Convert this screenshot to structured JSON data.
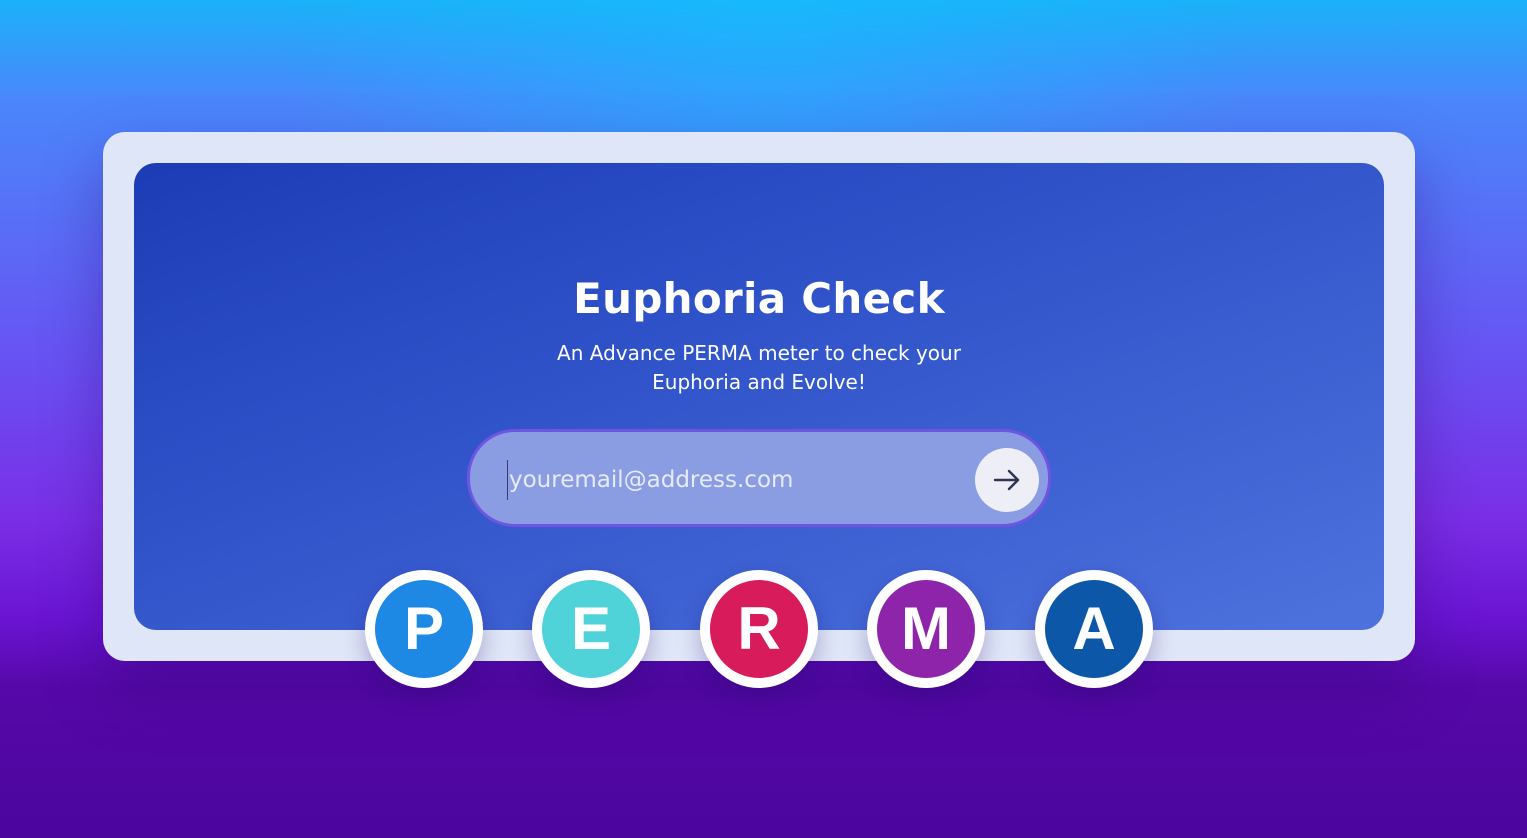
{
  "hero": {
    "title": "Euphoria Check",
    "subtitle_line1": "An Advance PERMA meter to check your",
    "subtitle_line2": "Euphoria and Evolve!"
  },
  "email_form": {
    "placeholder": "youremail@address.com",
    "value": "",
    "submit_icon": "arrow-right-icon"
  },
  "perma_badges": [
    {
      "letter": "P",
      "color": "#1e88e5"
    },
    {
      "letter": "E",
      "color": "#4fd3d9"
    },
    {
      "letter": "R",
      "color": "#d81b5a"
    },
    {
      "letter": "M",
      "color": "#8e24aa"
    },
    {
      "letter": "A",
      "color": "#0d57a8"
    }
  ],
  "colors": {
    "frame": "#dfe6f7",
    "panel_start": "#1c3cb6",
    "panel_end": "#4e72dd",
    "input_fill": "#8a9de3",
    "input_border": "#6f55e0",
    "button_fill": "#eeeff6"
  }
}
